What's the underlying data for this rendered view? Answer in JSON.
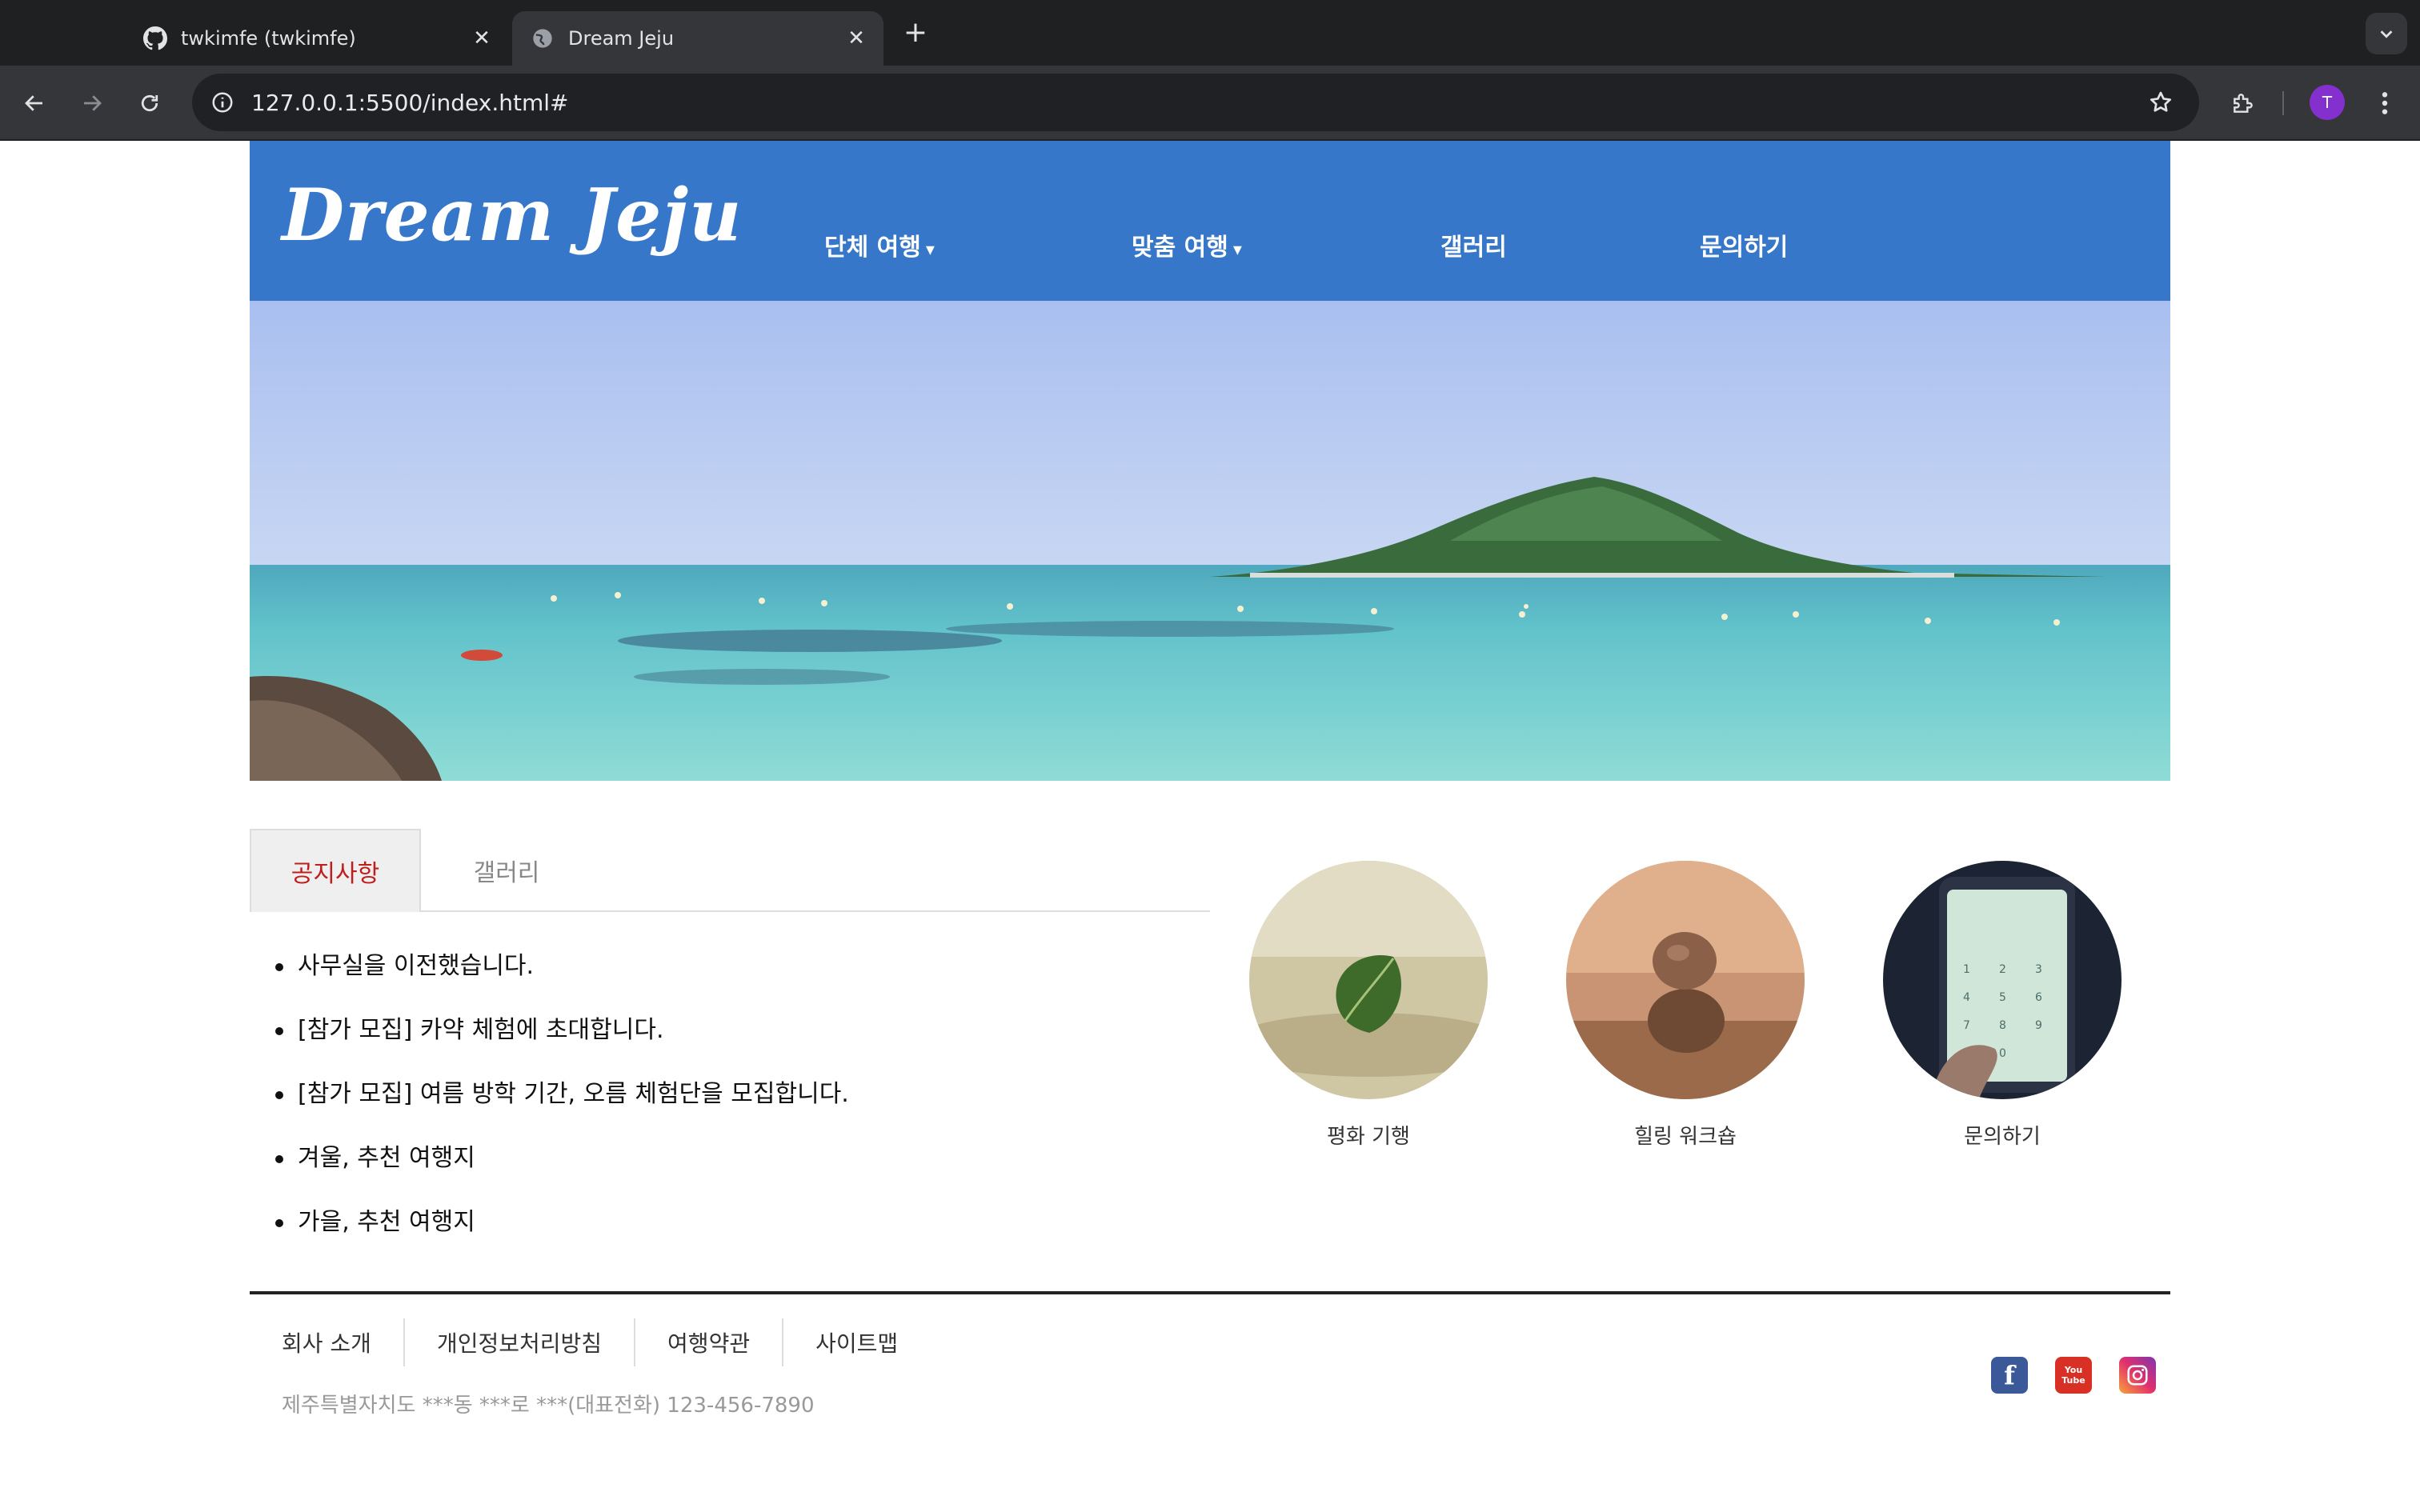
{
  "browser": {
    "tabs": [
      {
        "title": "twkimfe (twkimfe)",
        "icon": "github-icon",
        "active": false
      },
      {
        "title": "Dream Jeju",
        "icon": "globe-icon",
        "active": true
      }
    ],
    "url": "127.0.0.1:5500/index.html#",
    "profile_initial": "T",
    "accent": "#8430ce"
  },
  "header": {
    "logo": "Dream Jeju",
    "bg_color": "#3677c9",
    "nav": [
      {
        "label": "단체 여행",
        "caret": "▾"
      },
      {
        "label": "맞춤 여행",
        "caret": "▾"
      },
      {
        "label": "갤러리"
      },
      {
        "label": "문의하기"
      }
    ]
  },
  "content_tabs": [
    {
      "label": "공지사항",
      "active": true
    },
    {
      "label": "갤러리",
      "active": false
    }
  ],
  "notices": [
    "사무실을 이전했습니다.",
    "[참가 모집] 카약 체험에 초대합니다.",
    "[참가 모집] 여름 방학 기간, 오름 체험단을 모집합니다.",
    "겨울, 추천 여행지",
    "가을, 추천 여행지"
  ],
  "quick_links": [
    {
      "label": "평화 기행"
    },
    {
      "label": "힐링 워크숍"
    },
    {
      "label": "문의하기"
    }
  ],
  "footer": {
    "links": [
      "회사 소개",
      "개인정보처리방침",
      "여행약관",
      "사이트맵"
    ],
    "address": "제주특별자치도 ***동 ***로 ***(대표전화) 123-456-7890",
    "social": [
      {
        "name": "facebook-icon",
        "text": "f",
        "color": "#3b5998"
      },
      {
        "name": "youtube-icon",
        "text": "You Tube",
        "color": "#d93025"
      },
      {
        "name": "instagram-icon",
        "text": "",
        "color": "#c13584"
      }
    ]
  }
}
